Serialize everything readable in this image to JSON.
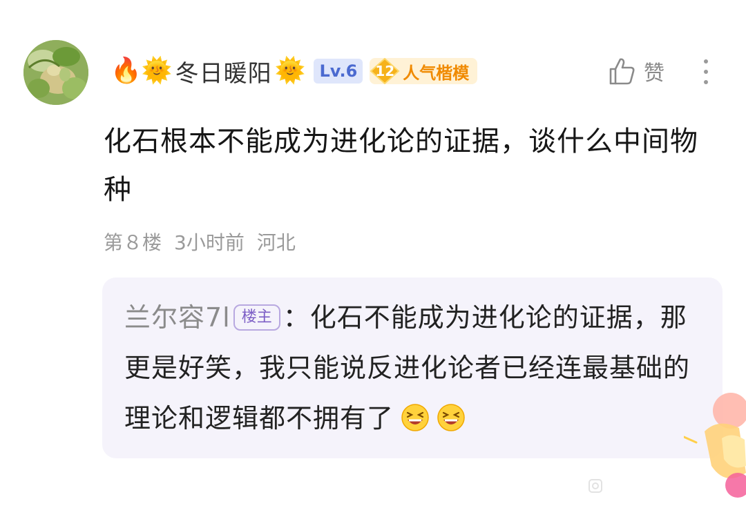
{
  "comment": {
    "username": "冬日暖阳",
    "level": "Lv.6",
    "tag": {
      "number": "12",
      "label": "人气楷模"
    },
    "like_label": "赞",
    "text": "化石根本不能成为进化论的证据，谈什么中间物种",
    "meta": {
      "floor": "第８楼",
      "time": "3小时前",
      "location": "河北"
    }
  },
  "reply": {
    "username": "兰尔容7l",
    "op_badge": "楼主",
    "separator": "：",
    "text": "化石不能成为进化论的证据，那更是好笑，我只能说反进化论者已经连最基础的理论和逻辑都不拥有了"
  },
  "icons": {
    "header_prefix": "fire-icon",
    "name_decor": "sun-icon",
    "like": "thumbs-up-icon",
    "more": "more-vertical-icon",
    "reply_suffix": "grinning-squint-icon"
  },
  "colors": {
    "level_badge_bg": "#dfe6fb",
    "level_badge_text": "#4b6ad0",
    "tag_text": "#f08a00",
    "reply_bg": "#f5f3fb",
    "op_badge_text": "#7d5fc6"
  }
}
